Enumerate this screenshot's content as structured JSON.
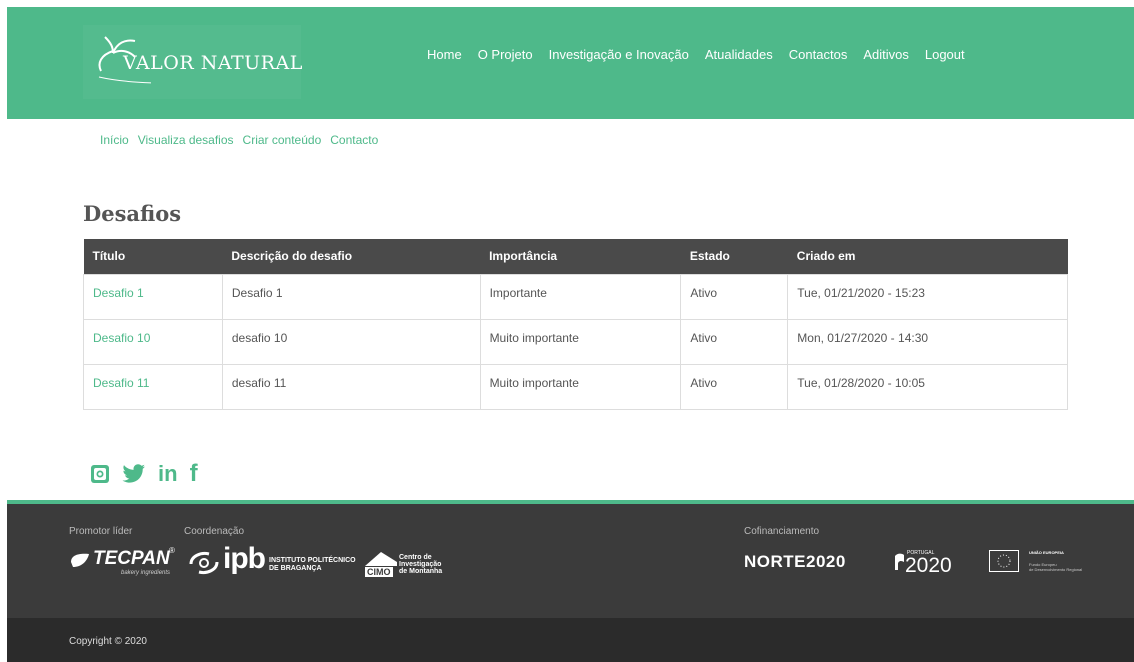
{
  "brand": {
    "name": "VALOR NATURAL"
  },
  "nav": {
    "items": [
      "Home",
      "O Projeto",
      "Investigação e Inovação",
      "Atualidades",
      "Contactos",
      "Aditivos",
      "Logout"
    ]
  },
  "subnav": {
    "items": [
      "Início",
      "Visualiza desafios",
      "Criar conteúdo",
      "Contacto"
    ]
  },
  "page": {
    "title": "Desafios"
  },
  "table": {
    "headers": [
      "Título",
      "Descrição do desafio",
      "Importância",
      "Estado",
      "Criado em"
    ],
    "rows": [
      {
        "title": "Desafio 1",
        "description": "Desafio 1",
        "importance": "Importante",
        "state": "Ativo",
        "created": "Tue, 01/21/2020 - 15:23"
      },
      {
        "title": "Desafio 10",
        "description": "desafio 10",
        "importance": "Muito importante",
        "state": "Ativo",
        "created": "Mon, 01/27/2020 - 14:30"
      },
      {
        "title": "Desafio 11",
        "description": "desafio 11",
        "importance": "Muito importante",
        "state": "Ativo",
        "created": "Tue, 01/28/2020 - 10:05"
      }
    ]
  },
  "social": {
    "icons": [
      "instagram-icon",
      "twitter-icon",
      "linkedin-icon",
      "facebook-icon"
    ],
    "linkedin_text": "in",
    "facebook_text": "f"
  },
  "footer": {
    "promoter_label": "Promotor líder",
    "coordination_label": "Coordenação",
    "cofinancing_label": "Cofinanciamento",
    "tecpan": {
      "name": "TECPAN",
      "tagline": "bakery ingredients",
      "mark": "®"
    },
    "ipb": {
      "short": "ipb",
      "line1": "INSTITUTO POLITÉCNICO",
      "line2": "DE BRAGANÇA"
    },
    "cimo": {
      "short": "CIMO",
      "line1": "Centro de",
      "line2": "Investigação",
      "line3": "de Montanha"
    },
    "norte": {
      "name": "NORTE2020"
    },
    "portugal": {
      "small": "PORTUGAL",
      "year": "2020"
    },
    "eu": {
      "line1": "UNIÃO EUROPEIA",
      "line2": "Fundo Europeu",
      "line3": "de Desenvolvimento Regional"
    },
    "copyright": "Copyright © 2020"
  },
  "colors": {
    "accent": "#4eb98a",
    "header_row": "#4a4a4a",
    "footer": "#3b3b3b",
    "copyright_bg": "#2b2b2b"
  }
}
